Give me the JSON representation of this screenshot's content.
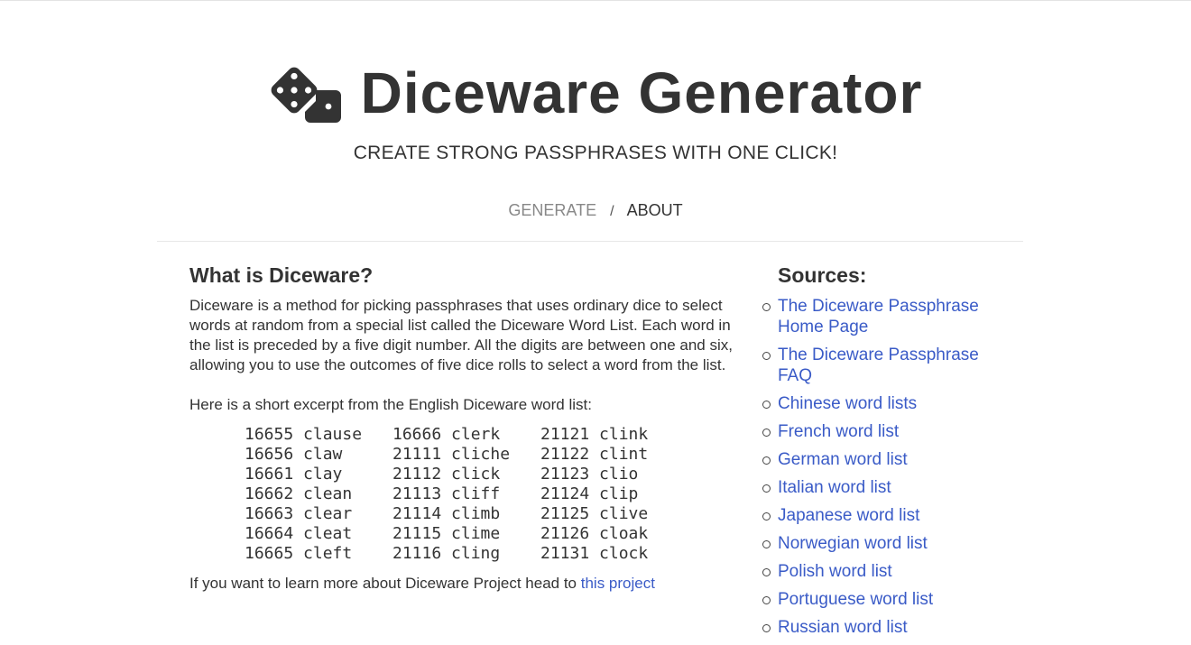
{
  "header": {
    "title": "Diceware Generator",
    "tagline": "CREATE STRONG PASSPHRASES WITH ONE CLICK!",
    "icon": "dice-icon"
  },
  "nav": {
    "generate": "GENERATE",
    "separator": "/",
    "about": "ABOUT"
  },
  "main": {
    "heading": "What is Diceware?",
    "paragraph1": "Diceware is a method for picking passphrases that uses ordinary dice to select words at random from a special list called the Diceware Word List. Each word in the list is preceded by a five digit number. All the digits are between one and six, allowing you to use the outcomes of five dice rolls to select a word from the list.",
    "paragraph2": "Here is a short excerpt from the English Diceware word list:",
    "wordlist": [
      [
        "16655 clause",
        "16666 clerk",
        "21121 clink"
      ],
      [
        "16656 claw",
        "21111 cliche",
        "21122 clint"
      ],
      [
        "16661 clay",
        "21112 click",
        "21123 clio"
      ],
      [
        "16662 clean",
        "21113 cliff",
        "21124 clip"
      ],
      [
        "16663 clear",
        "21114 climb",
        "21125 clive"
      ],
      [
        "16664 cleat",
        "21115 clime",
        "21126 cloak"
      ],
      [
        "16665 cleft",
        "21116 cling",
        "21131 clock"
      ]
    ],
    "paragraph3": "If you want to learn more about Diceware Project head to ",
    "paragraph3_link": "this project"
  },
  "sidebar": {
    "heading": "Sources:",
    "links": [
      "The Diceware Passphrase Home Page",
      "The Diceware Passphrase FAQ",
      "Chinese word lists",
      "French word list",
      "German word list",
      "Italian word list",
      "Japanese word list",
      "Norwegian word list",
      "Polish word list",
      "Portuguese word list",
      "Russian word list"
    ]
  },
  "colors": {
    "text": "#333333",
    "link": "#3a5bc7",
    "nav_inactive": "#888888"
  }
}
